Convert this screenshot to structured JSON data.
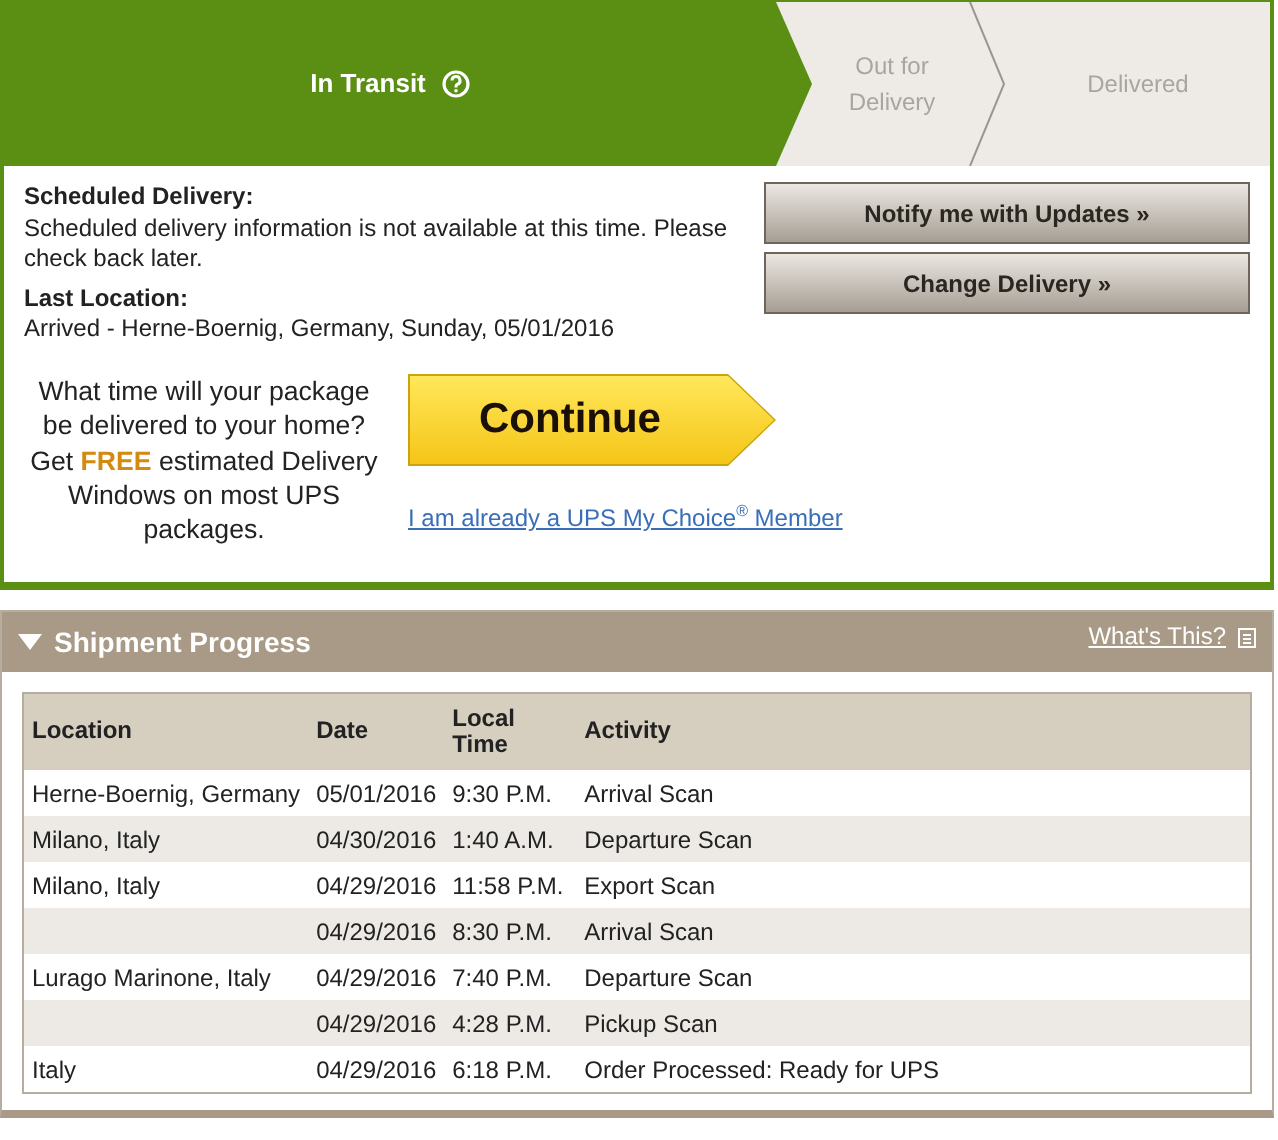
{
  "progress": {
    "steps": [
      {
        "label": "In Transit",
        "selected": true,
        "help": true
      },
      {
        "label": "Out for Delivery",
        "selected": false,
        "help": false
      },
      {
        "label": "Delivered",
        "selected": false,
        "help": false
      }
    ]
  },
  "scheduled": {
    "heading": "Scheduled Delivery:",
    "text": "Scheduled delivery information is not available at this time. Please check back later."
  },
  "last_location": {
    "heading": "Last Location:",
    "text": "Arrived - Herne-Boernig, Germany, Sunday, 05/01/2016"
  },
  "buttons": [
    "Notify me with Updates »",
    "Change Delivery »"
  ],
  "promo": {
    "text": "What time will your package be delivered to your home? Get **FREE** estimated Delivery Windows on most UPS packages.",
    "button": "Continue",
    "link": "I am already a UPS My Choice$^{®}$ Member"
  },
  "shipment_progress": {
    "title": "Shipment Progress",
    "expanded": true,
    "help_link": "What's This?",
    "columns": [
      "Location",
      "Date",
      "Local Time",
      "Activity"
    ],
    "rows": [
      [
        "Herne-Boernig, Germany",
        "05/01/2016",
        "9:30 P.M.",
        "Arrival Scan"
      ],
      [
        "Milano, Italy",
        "04/30/2016",
        "1:40 A.M.",
        "Departure Scan"
      ],
      [
        "Milano, Italy",
        "04/29/2016",
        "11:58 P.M.",
        "Export Scan"
      ],
      [
        "",
        "04/29/2016",
        "8:30 P.M.",
        "Arrival Scan"
      ],
      [
        "Lurago Marinone, Italy",
        "04/29/2016",
        "7:40 P.M.",
        "Departure Scan"
      ],
      [
        "",
        "04/29/2016",
        "4:28 P.M.",
        "Pickup Scan"
      ],
      [
        "Italy",
        "04/29/2016",
        "6:18 P.M.",
        "Order Processed: Ready for UPS"
      ]
    ]
  }
}
